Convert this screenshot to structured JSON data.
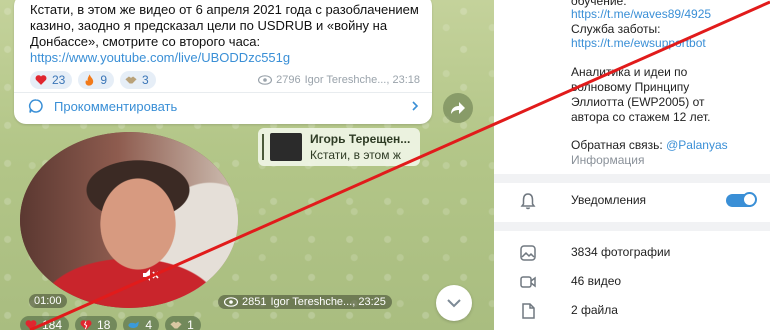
{
  "post": {
    "text_line1": "Кстати, в этом же видео от 6 апреля 2021 года с разоблачением",
    "text_line2": "казино, заодно я предсказал цели по USDRUB и «войну на",
    "text_line3": "Донбассе», смотрите со второго часа:",
    "link": "https://www.youtube.com/live/UBODDzc551g",
    "reactions": [
      {
        "icon": "heart-icon",
        "count": "23"
      },
      {
        "icon": "fire-icon",
        "count": "9"
      },
      {
        "icon": "handshake-icon",
        "count": "3"
      }
    ],
    "views": "2796",
    "author_time": "Igor Tereshche..., 23:18",
    "comment_label": "Прокомментировать"
  },
  "video_message": {
    "duration": "01:00",
    "reply_title": "Игорь Терещен...",
    "reply_text": "Кстати, в этом ж",
    "views": "2851",
    "author_time": "Igor Tereshche..., 23:25",
    "reactions": [
      {
        "icon": "heart-icon",
        "count": "184"
      },
      {
        "icon": "broken-heart-icon",
        "count": "18"
      },
      {
        "icon": "whale-icon",
        "count": "4"
      },
      {
        "icon": "handshake-icon",
        "count": "1"
      }
    ]
  },
  "info": {
    "top_cut": "обучение:",
    "link1": "https://t.me/waves89/4925",
    "support_label": "Служба заботы:",
    "link2": "https://t.me/ewsupportbot",
    "desc1": "Аналитика и идеи по",
    "desc2": "волновому Принципу",
    "desc3": "Эллиотта (EWP2005) от",
    "desc4": "автора со стажем 12 лет.",
    "feedback_prefix": "Обратная связь: ",
    "feedback_handle": "@Palanyas",
    "info_label": "Информация",
    "notifications": "Уведомления",
    "notifications_on": true,
    "photos": "3834 фотографии",
    "videos": "46 видео",
    "files": "2 файла"
  },
  "colors": {
    "accent": "#3a8fd6",
    "overlay_line": "#e11b1b"
  }
}
